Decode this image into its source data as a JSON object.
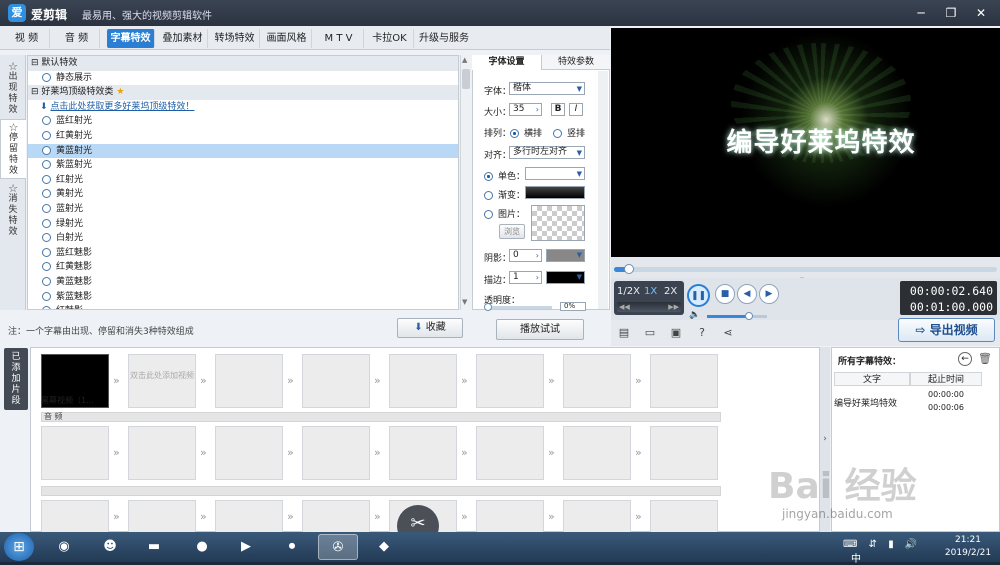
{
  "window": {
    "app_name": "爱剪辑",
    "slogan": "最易用、强大的视频剪辑软件",
    "logo_glyph": "爱"
  },
  "tabs": [
    {
      "label": "视 频",
      "active": false
    },
    {
      "label": "音 频",
      "active": false
    },
    {
      "label": "字幕特效",
      "active": true
    },
    {
      "label": "叠加素材",
      "active": false
    },
    {
      "label": "转场特效",
      "active": false
    },
    {
      "label": "画面风格",
      "active": false
    },
    {
      "label": "M T V",
      "active": false
    },
    {
      "label": "卡拉OK",
      "active": false
    },
    {
      "label": "升级与服务",
      "active": false
    }
  ],
  "side_tabs": [
    {
      "label": "出现特效",
      "active": false
    },
    {
      "label": "停留特效",
      "active": true
    },
    {
      "label": "消失特效",
      "active": false
    }
  ],
  "effects": {
    "group1": "默认特效",
    "group1_items": [
      "静态展示"
    ],
    "group2": "好莱坞顶级特效类",
    "promo_link": "点击此处获取更多好莱坞顶级特效！",
    "items": [
      "蓝红射光",
      "红黄射光",
      "黄蓝射光",
      "紫蓝射光",
      "红射光",
      "黄射光",
      "蓝射光",
      "绿射光",
      "白射光",
      "蓝红魅影",
      "红黄魅影",
      "黄蓝魅影",
      "紫蓝魅影",
      "红魅影"
    ],
    "selected": "黄蓝射光"
  },
  "note": "注：一个字幕由出现、停留和消失3种特效组成",
  "collect_label": "收藏",
  "font_panel": {
    "tab_font": "字体设置",
    "tab_effect": "特效参数",
    "font_label": "字体：",
    "font_value": "楷体",
    "size_label": "大小：",
    "size_value": "35",
    "bold": "B",
    "italic": "I",
    "layout_label": "排列：",
    "layout_h": "横排",
    "layout_v": "竖排",
    "align_label": "对齐：",
    "align_value": "多行时左对齐",
    "solid_label": "单色：",
    "gradient_label": "渐变：",
    "image_label": "图片：",
    "browse_label": "浏览",
    "shadow_label": "阴影：",
    "shadow_value": "0",
    "stroke_label": "描边：",
    "stroke_value": "1",
    "opacity_label": "透明度：",
    "opacity_value": "0%",
    "play_test": "播放试试"
  },
  "preview": {
    "caption": "编导好莱坞特效",
    "progress_fraction": 0.04
  },
  "player": {
    "speed_half": "1/2X",
    "speed_1x": "1X",
    "speed_2x": "2X",
    "current_time": "00:00:02.640",
    "total_time": "00:01:00.000",
    "volume_fraction": 0.7
  },
  "export_label": "导出视频",
  "timeline": {
    "added_tab": "已添加片段",
    "clip1_label": "黑幕视频（1...",
    "placeholder": "双击此处添加视频",
    "audio_label": "音 频"
  },
  "subtitles_panel": {
    "title": "所有字幕特效：",
    "col_text": "文字",
    "col_time": "起止时间",
    "rows": [
      {
        "text": "编导好莱坞特效",
        "start": "00:00:00",
        "end": "00:00:06"
      }
    ]
  },
  "taskbar": {
    "time": "21:21",
    "date": "2019/2/21"
  },
  "watermark": {
    "logo": "Bai 经验",
    "url": "jingyan.baidu.com"
  },
  "colors": {
    "accent": "#2a7fd4",
    "selection": "#b9d8f5",
    "dark_bar": "#2c2f34"
  }
}
